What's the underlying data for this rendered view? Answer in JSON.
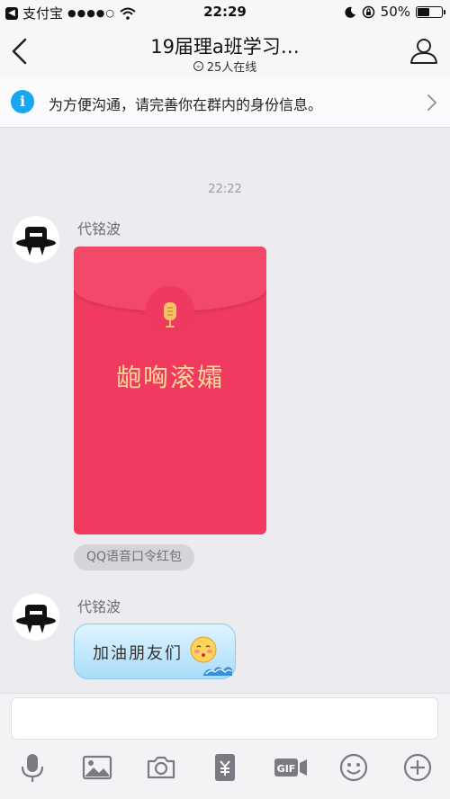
{
  "status_bar": {
    "back_app": "支付宝",
    "signal": "●●●●○",
    "time": "22:29",
    "battery": "50%",
    "battery_level": 0.5
  },
  "nav": {
    "title": "19届理a班学习…",
    "online": "25人在线",
    "icons": [
      "back-arrow-icon",
      "profile-icon"
    ]
  },
  "notice": {
    "text": "为方便沟通，请完善你在群内的身份信息。",
    "icon": "info-icon"
  },
  "chat": {
    "timestamp": "22:22",
    "messages": [
      {
        "sender": "代铭波",
        "type": "red-packet",
        "packet_text": "龅哅滚孀",
        "packet_label": "QQ语音口令红包"
      },
      {
        "sender": "代铭波",
        "type": "text",
        "text": "加油朋友们"
      }
    ]
  },
  "input": {
    "placeholder": "",
    "toolbar": [
      "microphone-icon",
      "image-icon",
      "camera-icon",
      "red-packet-icon",
      "gif-icon",
      "emoji-icon",
      "plus-icon"
    ]
  },
  "colors": {
    "accent": "#19a6f0",
    "packet": "#f03a5f",
    "packet_text": "#f7d79b",
    "bubble": "#a9dcf9"
  }
}
